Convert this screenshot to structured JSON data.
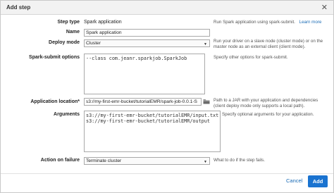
{
  "dialog": {
    "title": "Add step",
    "close": "✕"
  },
  "fields": {
    "step_type": {
      "label": "Step type",
      "value": "Spark application",
      "help": "Run Spark application using spark-submit.",
      "help_link": "Learn more"
    },
    "name": {
      "label": "Name",
      "value": "Spark application"
    },
    "deploy_mode": {
      "label": "Deploy mode",
      "value": "Cluster",
      "help_line1": "Run your driver on a slave node (cluster mode) or on the",
      "help_line2": "master node as an external client (client mode)."
    },
    "spark_submit": {
      "label": "Spark-submit options",
      "value": "--class com.jeanr.sparkjob.SparkJob",
      "help": "Specify other options for spark-submit."
    },
    "app_location": {
      "label": "Application location*",
      "value": "s3://my-first-emr-bucket/tutorialEMR/spark-job-0.0.1-S",
      "help_line1": "Path to a JAR with your application and dependencies",
      "help_line2": "(client deploy mode only supports a local path)."
    },
    "arguments": {
      "label": "Arguments",
      "value_line1": "s3://my-first-emr-bucket/tutorialEMR/input.txt",
      "value_line2": "s3://my-first-emr-bucket/tutorialEMR/output",
      "help": "Specify optional arguments for your application."
    },
    "action_on_failure": {
      "label": "Action on failure",
      "value": "Terminate cluster",
      "help": "What to do if the step fails."
    }
  },
  "footer": {
    "cancel": "Cancel",
    "add": "Add"
  },
  "colors": {
    "accent": "#1a73d0",
    "link": "#1a6bb5",
    "header_bg": "#f2f2f2"
  },
  "icons": {
    "folder": "folder-icon",
    "select_arrow": "chevron-down-icon"
  }
}
